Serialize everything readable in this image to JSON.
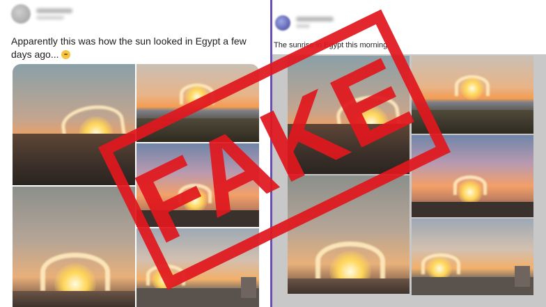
{
  "left_post": {
    "caption": "Apparently this was how the sun looked in Egypt a few days ago...",
    "emoji_icon": "thinking-face-emoji"
  },
  "right_post": {
    "caption": "The sunrise in Egypt this morning"
  },
  "stamp": {
    "label": "FAKE",
    "color": "#e0181e"
  },
  "divider_color": "#6a4fb3"
}
